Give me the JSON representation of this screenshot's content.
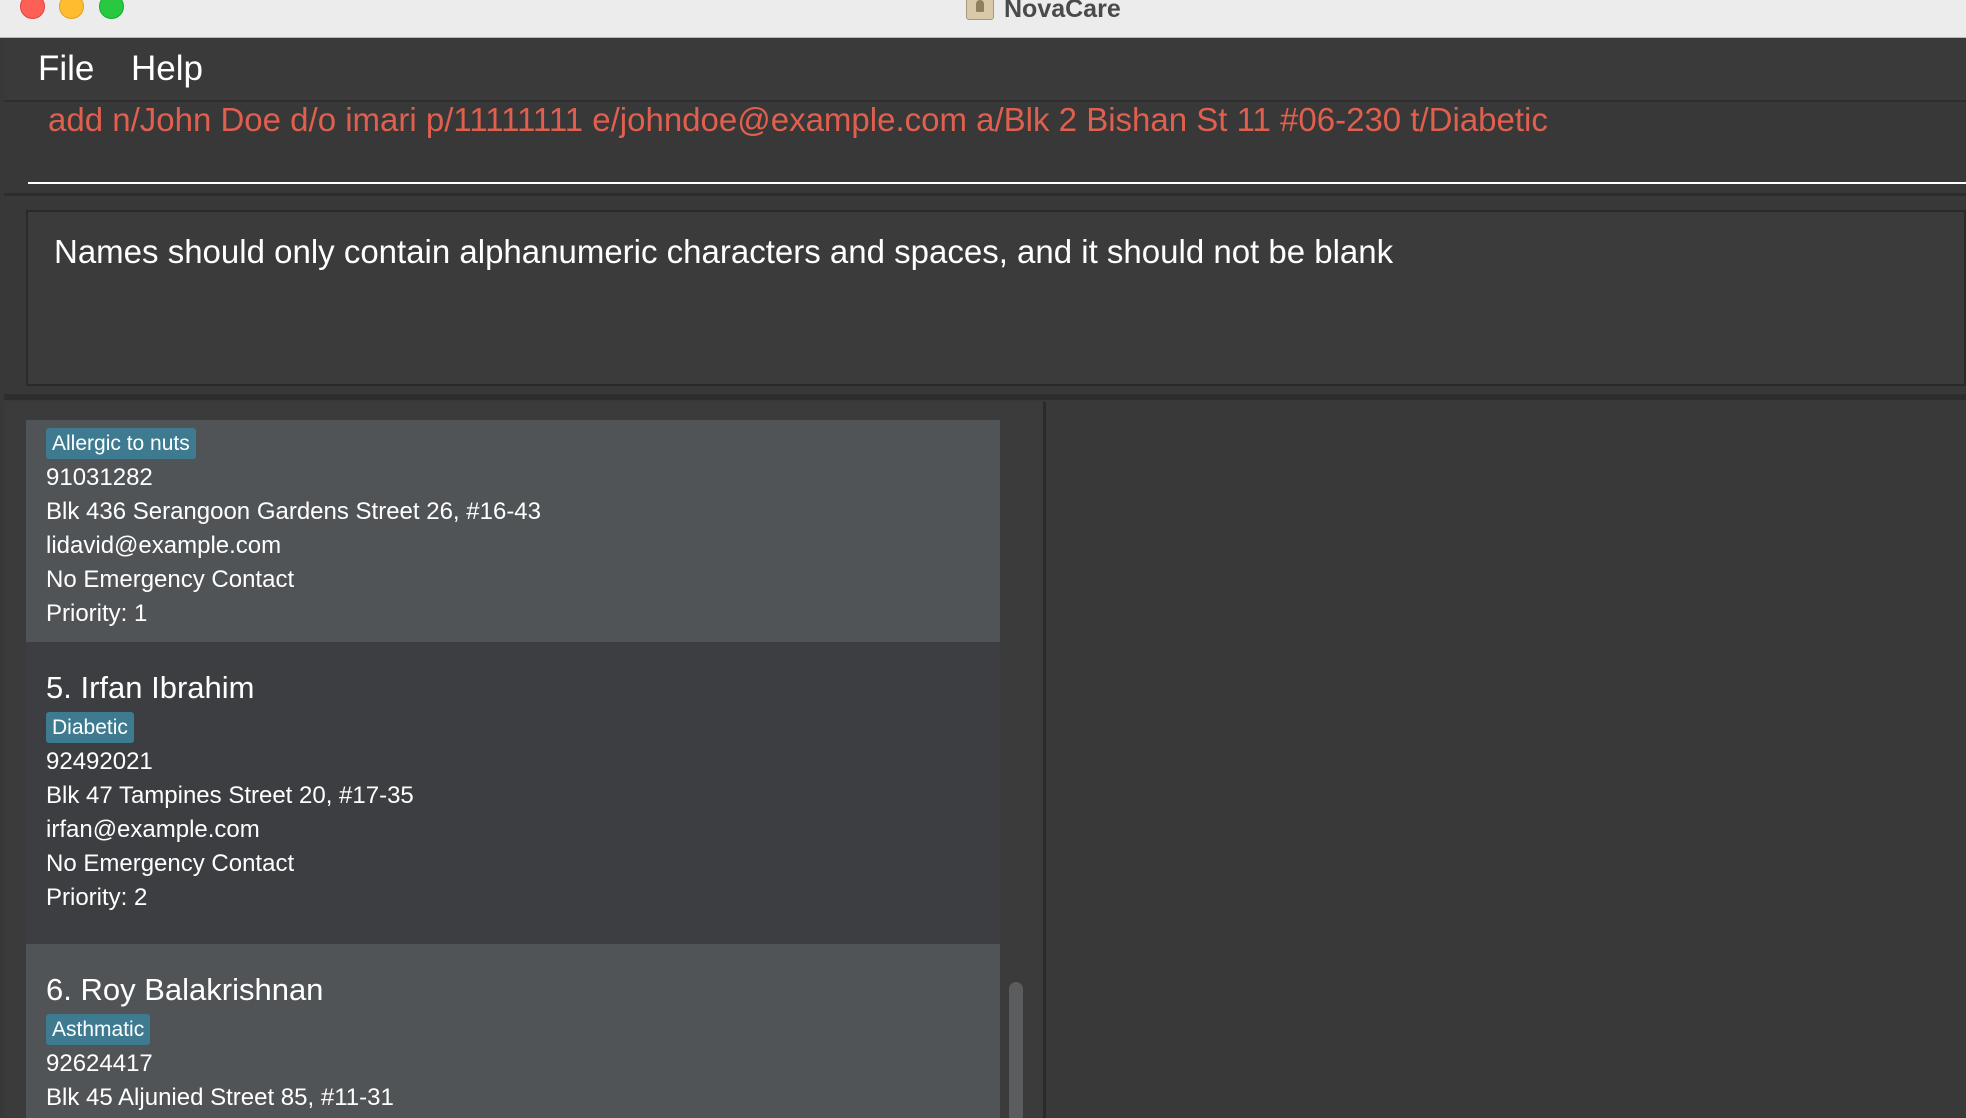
{
  "window": {
    "title": "NovaCare",
    "app_icon": "address-book-icon"
  },
  "menu": {
    "file": "File",
    "help": "Help"
  },
  "command": {
    "value": "add n/John Doe d/o imari  p/11111111 e/johndoe@example.com a/Blk 2 Bishan St 11 #06-230 t/Diabetic",
    "color": "#e05f4e"
  },
  "result": {
    "message": "Names should only contain alphanumeric characters and spaces, and it should not be blank"
  },
  "persons": [
    {
      "name": "",
      "tag": "Allergic to nuts",
      "phone": "91031282",
      "address": "Blk 436 Serangoon Gardens Street 26, #16-43",
      "email": "lidavid@example.com",
      "emergency": "No Emergency Contact",
      "priority": "Priority: 1"
    },
    {
      "name": "5. Irfan Ibrahim",
      "tag": "Diabetic",
      "phone": "92492021",
      "address": "Blk 47 Tampines Street 20, #17-35",
      "email": "irfan@example.com",
      "emergency": "No Emergency Contact",
      "priority": "Priority: 2"
    },
    {
      "name": "6. Roy Balakrishnan",
      "tag": "Asthmatic",
      "phone": "92624417",
      "address": "Blk 45 Aljunied Street 85, #11-31"
    }
  ],
  "colors": {
    "tag_background": "#3e7b91",
    "card_light": "#505457",
    "card_dark": "#3c3e41",
    "error_text": "#e05f4e"
  }
}
